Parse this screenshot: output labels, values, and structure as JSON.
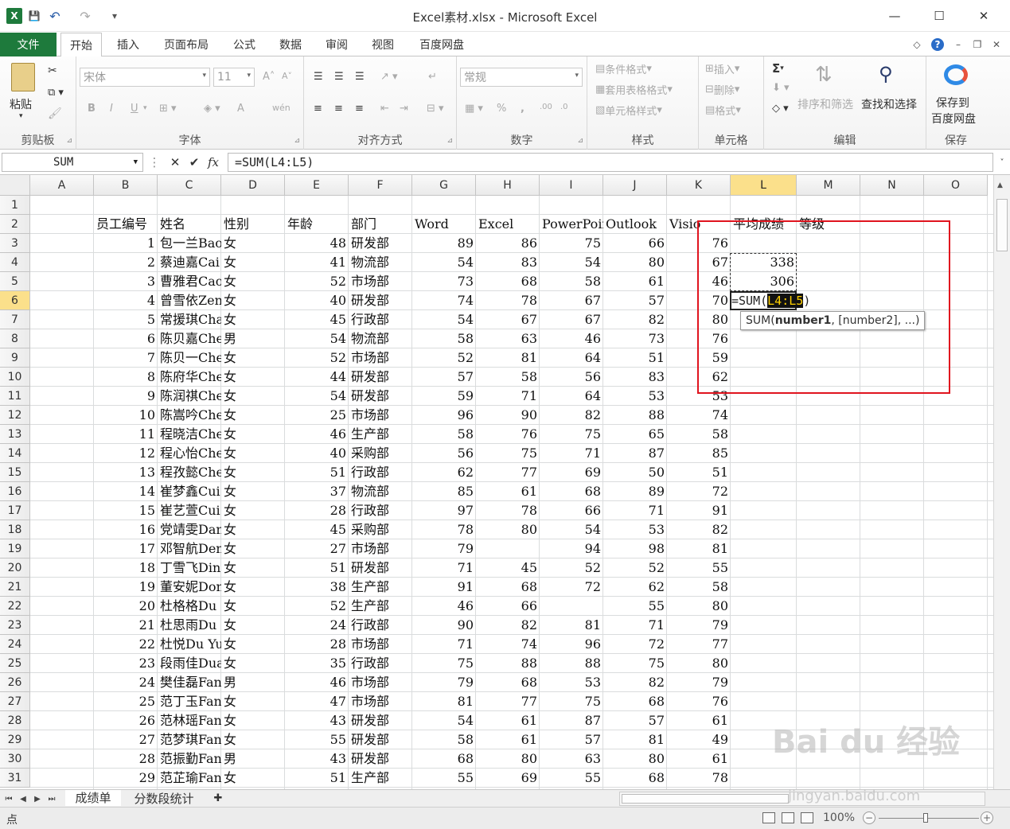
{
  "window": {
    "title": "Excel素材.xlsx - Microsoft Excel",
    "app_icon": "X",
    "minimize": "—",
    "maximize": "☐",
    "close": "✕"
  },
  "quick_access": {
    "save": "💾",
    "undo": "↶",
    "redo": "↷",
    "customize": "▾"
  },
  "ribbon_tabs": [
    {
      "label": "文件"
    },
    {
      "label": "开始"
    },
    {
      "label": "插入"
    },
    {
      "label": "页面布局"
    },
    {
      "label": "公式"
    },
    {
      "label": "数据"
    },
    {
      "label": "审阅"
    },
    {
      "label": "视图"
    },
    {
      "label": "百度网盘"
    }
  ],
  "ribbon_right": {
    "help": "?",
    "minimize_ribbon": "◇"
  },
  "ribbon": {
    "clipboard": {
      "label": "剪贴板",
      "paste": "粘贴"
    },
    "font": {
      "label": "字体",
      "name": "宋体",
      "size": "11",
      "bold": "B",
      "italic": "I",
      "underline": "U",
      "grow": "A˄",
      "shrink": "A˅",
      "font_color": "A",
      "phonetic": "wén"
    },
    "alignment": {
      "label": "对齐方式"
    },
    "number": {
      "label": "数字",
      "format": "常规",
      "percent": "%",
      "comma": ","
    },
    "styles": {
      "label": "样式",
      "conditional": "条件格式",
      "table": "套用表格格式",
      "cell_styles": "单元格样式"
    },
    "cells": {
      "label": "单元格",
      "insert": "插入",
      "delete": "删除",
      "format": "格式"
    },
    "editing": {
      "label": "编辑",
      "sum": "Σ",
      "sort": "排序和筛选",
      "find": "查找和选择"
    },
    "save": {
      "label": "保存",
      "baidu": "保存到",
      "baidu2": "百度网盘"
    }
  },
  "formula_bar": {
    "name_box": "SUM",
    "cancel": "✕",
    "enter": "✔",
    "fx": "fx",
    "formula": "=SUM(L4:L5)"
  },
  "columns": [
    "A",
    "B",
    "C",
    "D",
    "E",
    "F",
    "G",
    "H",
    "I",
    "J",
    "K",
    "L",
    "M",
    "N",
    "O"
  ],
  "selected_column": "L",
  "selected_row": "6",
  "header_row": {
    "B": "员工编号",
    "C": "姓名",
    "D": "性别",
    "E": "年龄",
    "F": "部门",
    "G": "Word",
    "H": "Excel",
    "I": "PowerPoint",
    "J": "Outlook",
    "K": "Visio",
    "L": "平均成绩",
    "M": "等级"
  },
  "rows": [
    [
      "1",
      "包一兰Bao",
      "女",
      "48",
      "研发部",
      "89",
      "86",
      "75",
      "66",
      "76"
    ],
    [
      "2",
      "蔡迪嘉Cai",
      "女",
      "41",
      "物流部",
      "54",
      "83",
      "54",
      "80",
      "67"
    ],
    [
      "3",
      "曹雅君Cao",
      "女",
      "52",
      "市场部",
      "73",
      "68",
      "58",
      "61",
      "46"
    ],
    [
      "4",
      "曾雪依Zen",
      "女",
      "40",
      "研发部",
      "74",
      "78",
      "67",
      "57",
      "70"
    ],
    [
      "5",
      "常援琪Cha",
      "女",
      "45",
      "行政部",
      "54",
      "67",
      "67",
      "82",
      "80"
    ],
    [
      "6",
      "陈贝嘉Che",
      "男",
      "54",
      "物流部",
      "58",
      "63",
      "46",
      "73",
      "76"
    ],
    [
      "7",
      "陈贝一Che",
      "女",
      "52",
      "市场部",
      "52",
      "81",
      "64",
      "51",
      "59"
    ],
    [
      "8",
      "陈府华Che",
      "女",
      "44",
      "研发部",
      "57",
      "58",
      "56",
      "83",
      "62"
    ],
    [
      "9",
      "陈润祺Che",
      "女",
      "54",
      "研发部",
      "59",
      "71",
      "64",
      "53",
      "53"
    ],
    [
      "10",
      "陈嵩吟Che",
      "女",
      "25",
      "市场部",
      "96",
      "90",
      "82",
      "88",
      "74"
    ],
    [
      "11",
      "程晓洁Che",
      "女",
      "46",
      "生产部",
      "58",
      "76",
      "75",
      "65",
      "58"
    ],
    [
      "12",
      "程心怡Che",
      "女",
      "40",
      "采购部",
      "56",
      "75",
      "71",
      "87",
      "85"
    ],
    [
      "13",
      "程孜懿Che",
      "女",
      "51",
      "行政部",
      "62",
      "77",
      "69",
      "50",
      "51"
    ],
    [
      "14",
      "崔梦鑫Cui",
      "女",
      "37",
      "物流部",
      "85",
      "61",
      "68",
      "89",
      "72"
    ],
    [
      "15",
      "崔艺萱Cui",
      "女",
      "28",
      "行政部",
      "97",
      "78",
      "66",
      "71",
      "91"
    ],
    [
      "16",
      "党靖雯Dan",
      "女",
      "45",
      "采购部",
      "78",
      "80",
      "54",
      "53",
      "82"
    ],
    [
      "17",
      "邓智航Den",
      "女",
      "27",
      "市场部",
      "79",
      "",
      "94",
      "98",
      "81"
    ],
    [
      "18",
      "丁雪飞Din",
      "女",
      "51",
      "研发部",
      "71",
      "45",
      "52",
      "52",
      "55"
    ],
    [
      "19",
      "董安妮Don",
      "女",
      "38",
      "生产部",
      "91",
      "68",
      "72",
      "62",
      "58"
    ],
    [
      "20",
      "杜格格Du",
      "女",
      "52",
      "生产部",
      "46",
      "66",
      "",
      "55",
      "80"
    ],
    [
      "21",
      "杜思雨Du",
      "女",
      "24",
      "行政部",
      "90",
      "82",
      "81",
      "71",
      "79"
    ],
    [
      "22",
      "杜悦Du Yu",
      "女",
      "28",
      "市场部",
      "71",
      "74",
      "96",
      "72",
      "77"
    ],
    [
      "23",
      "段雨佳Dua",
      "女",
      "35",
      "行政部",
      "75",
      "88",
      "88",
      "75",
      "80"
    ],
    [
      "24",
      "樊佳磊Fan",
      "男",
      "46",
      "市场部",
      "79",
      "68",
      "53",
      "82",
      "79"
    ],
    [
      "25",
      "范丁玉Fan",
      "女",
      "47",
      "市场部",
      "81",
      "77",
      "75",
      "68",
      "76"
    ],
    [
      "26",
      "范林瑶Fan",
      "女",
      "43",
      "研发部",
      "54",
      "61",
      "87",
      "57",
      "61"
    ],
    [
      "27",
      "范梦琪Fan",
      "女",
      "55",
      "研发部",
      "58",
      "61",
      "57",
      "81",
      "49"
    ],
    [
      "28",
      "范振勤Fan",
      "男",
      "43",
      "研发部",
      "68",
      "80",
      "63",
      "80",
      "61"
    ],
    [
      "29",
      "范芷瑜Fan",
      "女",
      "51",
      "生产部",
      "55",
      "69",
      "55",
      "68",
      "78"
    ]
  ],
  "l_values": {
    "4": "338",
    "5": "306"
  },
  "editing": {
    "prefix": "=SUM(",
    "ref": "L4:L5",
    "suffix": ")"
  },
  "tooltip": {
    "fn": "SUM(",
    "arg1": "number1",
    "rest": ", [number2], ...)"
  },
  "sheets": [
    {
      "label": "成绩单"
    },
    {
      "label": "分数段统计"
    }
  ],
  "status": {
    "mode": "点",
    "zoom": "100%"
  },
  "watermark": {
    "main": "Bai du 经验",
    "sub": "jingyan.baidu.com"
  },
  "colors": {
    "accent": "#1e7a3c",
    "highlight": "#e0141e",
    "selected_header": "#fbe08b"
  }
}
